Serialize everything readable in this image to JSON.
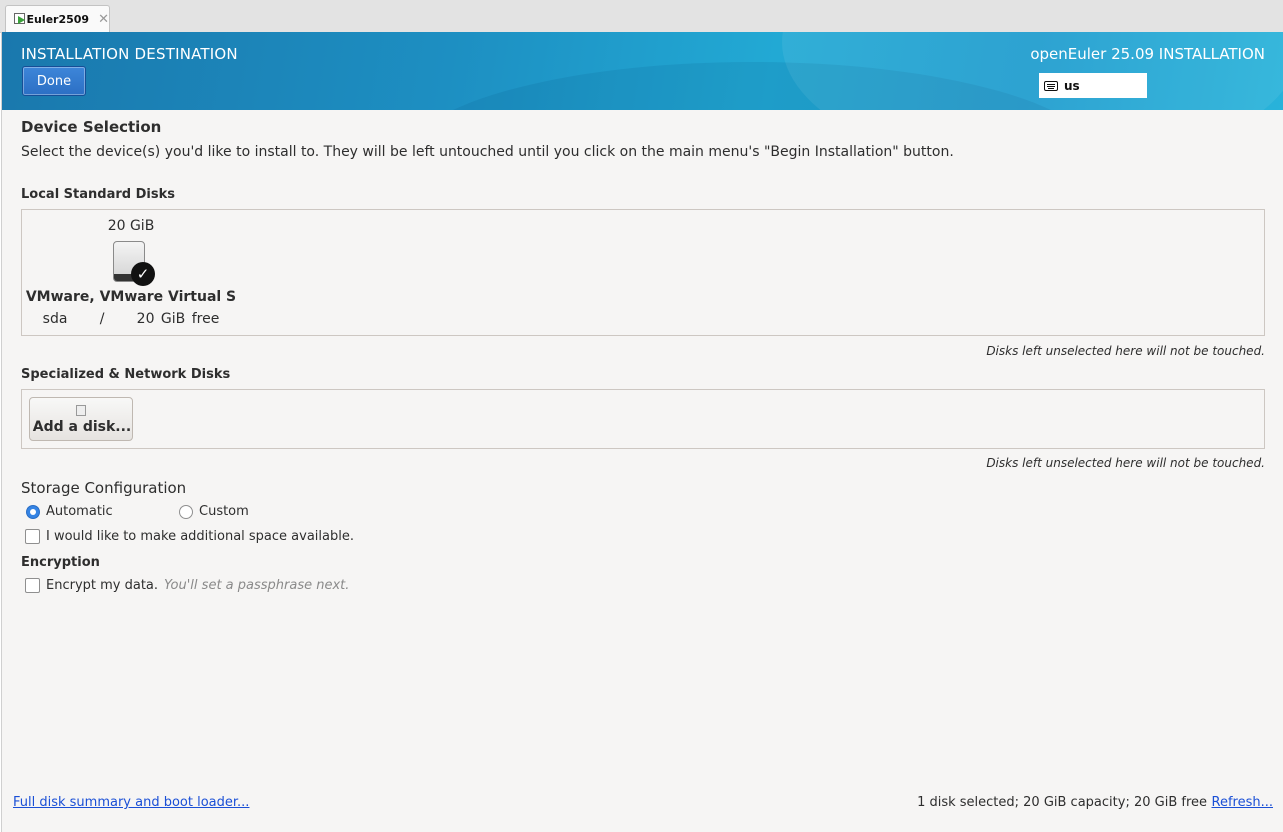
{
  "vm_tab": {
    "label": "Euler2509",
    "close": "✕"
  },
  "header": {
    "title": "INSTALLATION DESTINATION",
    "done_label": "Done",
    "product": "openEuler 25.09 INSTALLATION",
    "keyboard_layout": "us",
    "accent": "#1d8fc2"
  },
  "device_selection": {
    "heading": "Device Selection",
    "description": "Select the device(s) you'd like to install to.  They will be left untouched until you click on the main menu's \"Begin Installation\" button."
  },
  "local_disks": {
    "heading": "Local Standard Disks",
    "disks": [
      {
        "size": "20 GiB",
        "name": "VMware, VMware Virtual S",
        "device": "sda",
        "separator": "/",
        "free": "20 GiB free",
        "selected": true
      }
    ],
    "note": "Disks left unselected here will not be touched."
  },
  "specialized_disks": {
    "heading": "Specialized & Network Disks",
    "add_label": "Add a disk...",
    "note": "Disks left unselected here will not be touched."
  },
  "storage_configuration": {
    "heading": "Storage Configuration",
    "automatic_label": "Automatic",
    "custom_label": "Custom",
    "selected": "Automatic",
    "additional_space_label": "I would like to make additional space available."
  },
  "encryption": {
    "heading": "Encryption",
    "encrypt_label": "Encrypt my data.",
    "hint": "You'll set a passphrase next."
  },
  "footer": {
    "summary_link": "Full disk summary and boot loader...",
    "status": "1 disk selected; 20 GiB capacity; 20 GiB free",
    "refresh_link": "Refresh..."
  }
}
